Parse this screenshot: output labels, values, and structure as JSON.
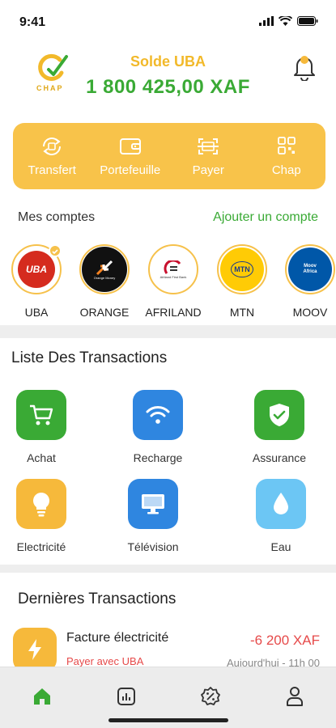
{
  "status_bar": {
    "time": "9:41"
  },
  "header": {
    "logo_text": "CHAP",
    "balance_label": "Solde UBA",
    "balance_value": "1 800 425,00 XAF"
  },
  "actions": [
    {
      "label": "Transfert",
      "icon": "transfer-icon"
    },
    {
      "label": "Portefeuille",
      "icon": "wallet-icon"
    },
    {
      "label": "Payer",
      "icon": "scan-icon"
    },
    {
      "label": "Chap",
      "icon": "qr-code-icon"
    }
  ],
  "accounts": {
    "title": "Mes comptes",
    "add_label": "Ajouter un compte",
    "items": [
      {
        "name": "UBA",
        "logo_text": "UBA",
        "selected": true
      },
      {
        "name": "ORANGE",
        "logo_text": "Orange Money",
        "selected": false
      },
      {
        "name": "AFRILAND",
        "logo_text": "Afriland First Bank",
        "selected": false
      },
      {
        "name": "MTN",
        "logo_text": "MTN",
        "selected": false
      },
      {
        "name": "MOOV",
        "logo_text": "Moov Africa",
        "selected": false
      }
    ]
  },
  "transactions_list": {
    "title": "Liste Des Transactions",
    "items": [
      {
        "label": "Achat",
        "icon": "cart-icon",
        "color": "#3aaa35"
      },
      {
        "label": "Recharge",
        "icon": "wifi-icon",
        "color": "#2f86e0"
      },
      {
        "label": "Assurance",
        "icon": "shield-check-icon",
        "color": "#3aaa35"
      },
      {
        "label": "Electricité",
        "icon": "lightbulb-icon",
        "color": "#f6b93b"
      },
      {
        "label": "Télévision",
        "icon": "monitor-icon",
        "color": "#2f86e0"
      },
      {
        "label": "Eau",
        "icon": "water-drop-icon",
        "color": "#6cc6f4"
      }
    ]
  },
  "recent": {
    "title": "Dernières Transactions",
    "items": [
      {
        "name": "Facture électricité",
        "subtitle": "Payer avec UBA",
        "amount": "-6 200 XAF",
        "date": "Aujourd'hui - 11h 00",
        "icon": "lightning-icon"
      }
    ]
  },
  "tabbar": [
    {
      "name": "home",
      "icon": "home-icon",
      "active": true
    },
    {
      "name": "stats",
      "icon": "chart-icon",
      "active": false
    },
    {
      "name": "promo",
      "icon": "percent-badge-icon",
      "active": false
    },
    {
      "name": "profile",
      "icon": "user-icon",
      "active": false
    }
  ],
  "colors": {
    "accent_yellow": "#f8c34a",
    "accent_green": "#3aaa35",
    "negative_red": "#e64a4a"
  }
}
